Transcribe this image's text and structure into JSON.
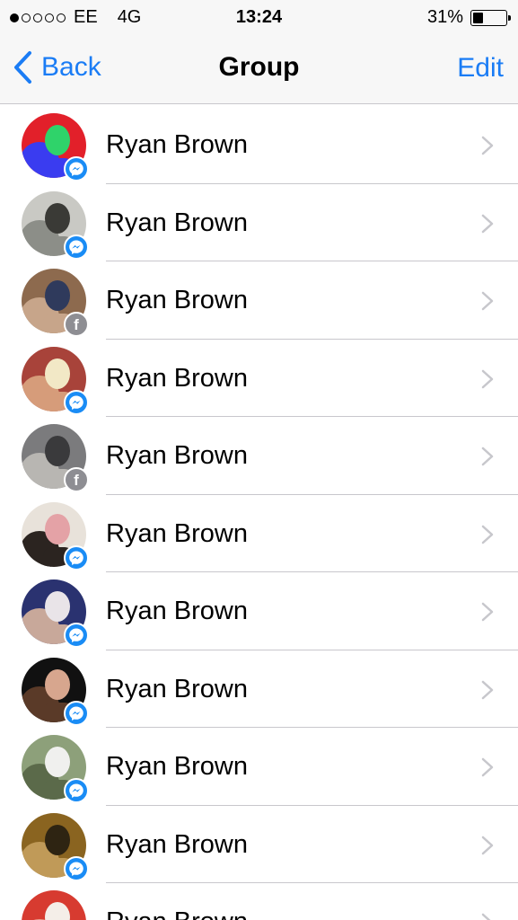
{
  "status_bar": {
    "signal_dots": [
      true,
      false,
      false,
      false,
      false
    ],
    "carrier": "EE",
    "network": "4G",
    "time": "13:24",
    "battery_percent": "31%",
    "battery_level": 0.31
  },
  "nav": {
    "back_label": "Back",
    "title": "Group",
    "edit_label": "Edit"
  },
  "colors": {
    "accent": "#1a7cf5",
    "messenger_badge": "#1a8cf5",
    "facebook_badge": "#8e8e93",
    "separator": "#c8c7cc"
  },
  "members": [
    {
      "name": "Ryan Brown",
      "badge": "messenger-icon",
      "avatar_colors": [
        "#e2202a",
        "#2fd36a",
        "#3a3cf0"
      ]
    },
    {
      "name": "Ryan Brown",
      "badge": "messenger-icon",
      "avatar_colors": [
        "#c9c9c4",
        "#3a3a36",
        "#8c8e88"
      ]
    },
    {
      "name": "Ryan Brown",
      "badge": "facebook-icon",
      "avatar_colors": [
        "#8d6a4e",
        "#2f3a5c",
        "#c7a58a"
      ]
    },
    {
      "name": "Ryan Brown",
      "badge": "messenger-icon",
      "avatar_colors": [
        "#a8433a",
        "#f2e8c6",
        "#d69c7a"
      ]
    },
    {
      "name": "Ryan Brown",
      "badge": "facebook-icon",
      "avatar_colors": [
        "#7b7b7d",
        "#3a3a3c",
        "#b8b6b2"
      ]
    },
    {
      "name": "Ryan Brown",
      "badge": "messenger-icon",
      "avatar_colors": [
        "#e8e2da",
        "#e4a2a6",
        "#2b2420"
      ]
    },
    {
      "name": "Ryan Brown",
      "badge": "messenger-icon",
      "avatar_colors": [
        "#2a3270",
        "#e9e4e8",
        "#c8a89a"
      ]
    },
    {
      "name": "Ryan Brown",
      "badge": "messenger-icon",
      "avatar_colors": [
        "#111111",
        "#d7a68e",
        "#5a3a28"
      ]
    },
    {
      "name": "Ryan Brown",
      "badge": "messenger-icon",
      "avatar_colors": [
        "#8da07a",
        "#f0f0ee",
        "#5b6a4a"
      ]
    },
    {
      "name": "Ryan Brown",
      "badge": "messenger-icon",
      "avatar_colors": [
        "#8a6420",
        "#2e2412",
        "#c09a58"
      ]
    },
    {
      "name": "Ryan Brown",
      "badge": "messenger-icon",
      "avatar_colors": [
        "#d73b30",
        "#f4eee8",
        "#e8a090"
      ]
    }
  ]
}
